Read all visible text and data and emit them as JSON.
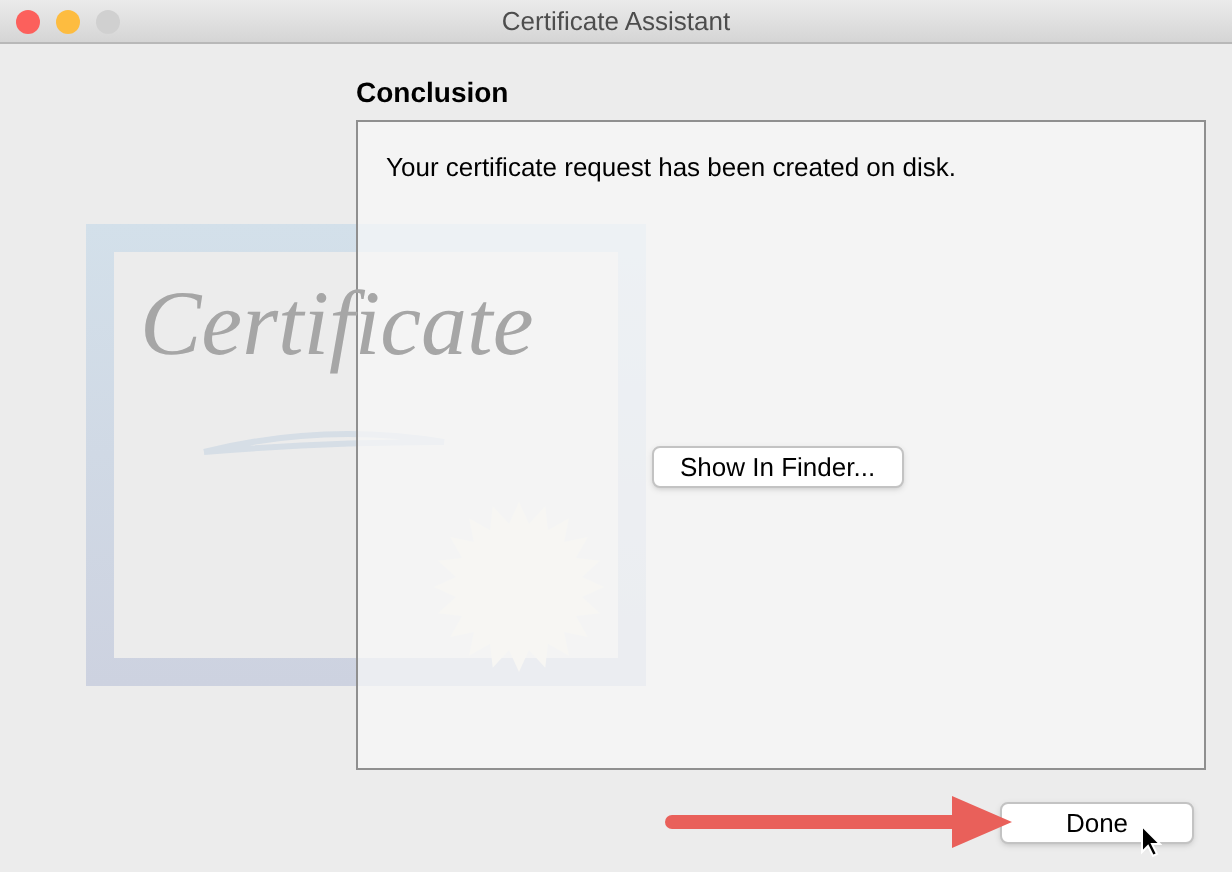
{
  "window": {
    "title": "Certificate Assistant",
    "buttons": [
      {
        "color": "#fc605c"
      },
      {
        "color": "#fdbc40"
      },
      {
        "color": "#d0d0d0"
      }
    ]
  },
  "artwork": {
    "text": "Certificate"
  },
  "heading": "Conclusion",
  "message": "Your certificate request has been created on disk.",
  "show_button": "Show In Finder...",
  "done_button": "Done"
}
